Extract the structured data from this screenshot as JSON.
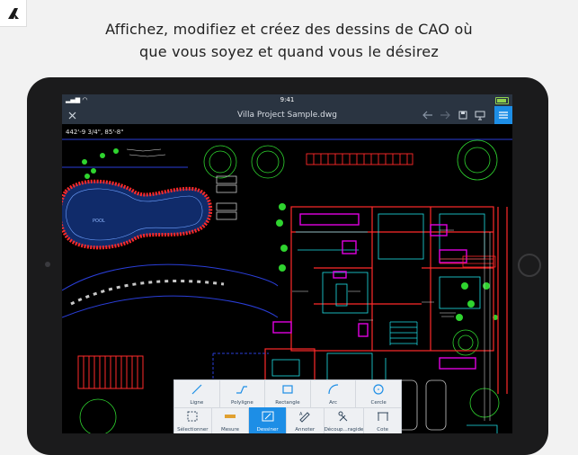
{
  "headline": {
    "line1": "Affichez, modifiez et créez des dessins de CAO où",
    "line2": "que vous soyez et quand vous le désirez"
  },
  "status": {
    "time": "9:41"
  },
  "app": {
    "title": "Villa Project Sample.dwg",
    "coordinates": "442'-9 3/4\",  85'-8\""
  },
  "drawing_labels": {
    "pool": "POOL"
  },
  "toolbar": {
    "draw_tools": [
      {
        "label": "Ligne",
        "icon": "line-icon"
      },
      {
        "label": "Polyligne",
        "icon": "polyline-icon"
      },
      {
        "label": "Rectangle",
        "icon": "rectangle-icon"
      },
      {
        "label": "Arc",
        "icon": "arc-icon"
      },
      {
        "label": "Cercle",
        "icon": "circle-icon"
      }
    ],
    "modes": [
      {
        "label": "Sélectionner",
        "icon": "select-icon"
      },
      {
        "label": "Mesure",
        "icon": "ruler-icon"
      },
      {
        "label": "Dessiner",
        "icon": "draw-icon",
        "active": true
      },
      {
        "label": "Annoter",
        "icon": "annotate-icon"
      },
      {
        "label": "Découp...ragide",
        "icon": "trim-icon"
      },
      {
        "label": "Cote",
        "icon": "dimension-icon"
      }
    ]
  },
  "colors": {
    "accent": "#1d8ee6",
    "titlebar": "#2a3441",
    "wall_red": "#ff2a2a",
    "cad_cyan": "#1ee0e8",
    "cad_magenta": "#e000e0",
    "cad_green": "#2fd42f"
  }
}
